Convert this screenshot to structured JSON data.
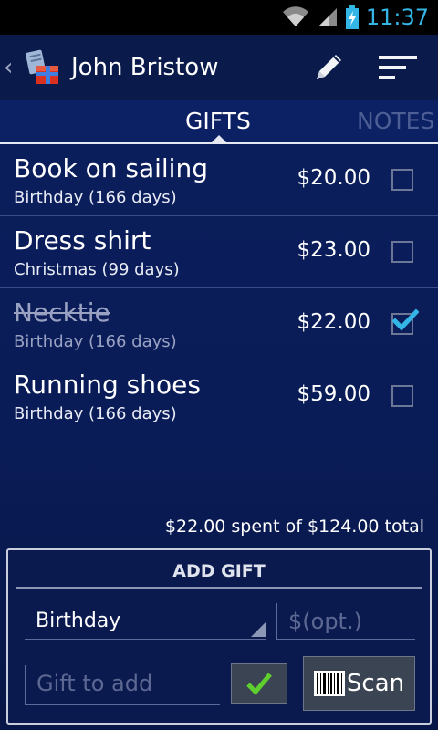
{
  "status_bar": {
    "time": "11:37"
  },
  "action_bar": {
    "title": "John Bristow"
  },
  "tabs": [
    {
      "label": "GIFTS",
      "active": true
    },
    {
      "label": "NOTES",
      "active": false
    }
  ],
  "gifts": [
    {
      "name": "Book on sailing",
      "occasion": "Birthday (166 days)",
      "price": "$20.00",
      "checked": false
    },
    {
      "name": "Dress shirt",
      "occasion": "Christmas (99 days)",
      "price": "$23.00",
      "checked": false
    },
    {
      "name": "Necktie",
      "occasion": "Birthday (166 days)",
      "price": "$22.00",
      "checked": true
    },
    {
      "name": "Running shoes",
      "occasion": "Birthday (166 days)",
      "price": "$59.00",
      "checked": false
    }
  ],
  "summary": "$22.00 spent of $124.00 total",
  "add_gift": {
    "title": "ADD GIFT",
    "occasion": "Birthday",
    "price_placeholder": "$(opt.)",
    "gift_placeholder": "Gift to add",
    "scan_label": "Scan"
  },
  "colors": {
    "accent": "#33b5e5",
    "background": "#0b1f5e",
    "confirm_check": "#5fcf2f"
  },
  "icons": {
    "up": "chevron-left-icon",
    "app": "gift-list-icon",
    "edit": "pencil-icon",
    "sort": "sort-icon",
    "confirm": "checkmark-icon",
    "scan": "barcode-icon"
  }
}
